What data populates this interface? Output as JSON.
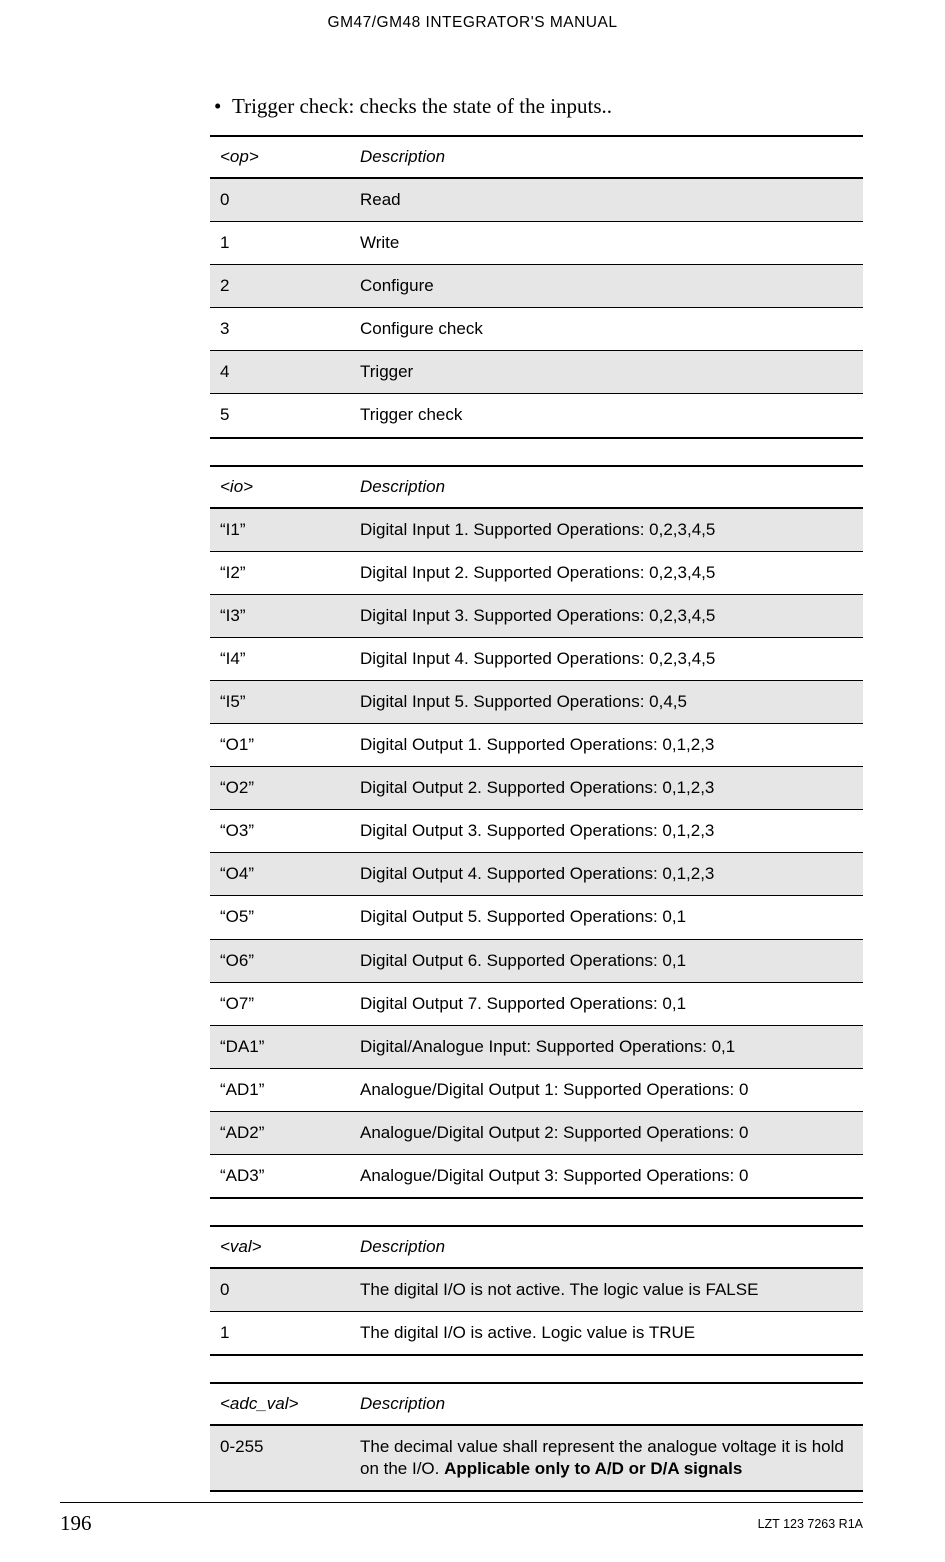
{
  "header": {
    "title": "GM47/GM48 INTEGRATOR'S MANUAL"
  },
  "bullet": {
    "dot": "•",
    "text": "Trigger check: checks the state of the inputs.."
  },
  "table_op": {
    "head": {
      "col1": "<op>",
      "col2": "Description"
    },
    "rows": [
      {
        "c1": "0",
        "c2": "Read"
      },
      {
        "c1": "1",
        "c2": "Write"
      },
      {
        "c1": "2",
        "c2": "Configure"
      },
      {
        "c1": "3",
        "c2": "Configure check"
      },
      {
        "c1": "4",
        "c2": "Trigger"
      },
      {
        "c1": "5",
        "c2": "Trigger check"
      }
    ]
  },
  "table_io": {
    "head": {
      "col1": "<io>",
      "col2": "Description"
    },
    "rows": [
      {
        "c1": "“I1”",
        "c2": "Digital Input 1. Supported Operations: 0,2,3,4,5"
      },
      {
        "c1": "“I2”",
        "c2": "Digital Input 2. Supported Operations: 0,2,3,4,5"
      },
      {
        "c1": "“I3”",
        "c2": "Digital Input 3. Supported Operations: 0,2,3,4,5"
      },
      {
        "c1": "“I4”",
        "c2": "Digital Input 4. Supported Operations: 0,2,3,4,5"
      },
      {
        "c1": "“I5”",
        "c2": "Digital Input 5. Supported Operations: 0,4,5"
      },
      {
        "c1": "“O1”",
        "c2": "Digital Output 1. Supported Operations: 0,1,2,3"
      },
      {
        "c1": "“O2”",
        "c2": "Digital Output 2. Supported Operations: 0,1,2,3"
      },
      {
        "c1": "“O3”",
        "c2": "Digital Output 3. Supported Operations: 0,1,2,3"
      },
      {
        "c1": "“O4”",
        "c2": "Digital Output 4. Supported Operations: 0,1,2,3"
      },
      {
        "c1": "“O5”",
        "c2": "Digital Output 5. Supported Operations: 0,1"
      },
      {
        "c1": "“O6”",
        "c2": "Digital Output 6. Supported Operations: 0,1"
      },
      {
        "c1": "“O7”",
        "c2": "Digital Output 7. Supported Operations: 0,1"
      },
      {
        "c1": "“DA1”",
        "c2": "Digital/Analogue Input: Supported Operations: 0,1"
      },
      {
        "c1": "“AD1”",
        "c2": "Analogue/Digital Output 1: Supported Operations: 0"
      },
      {
        "c1": "“AD2”",
        "c2": "Analogue/Digital Output 2: Supported Operations: 0"
      },
      {
        "c1": "“AD3”",
        "c2": "Analogue/Digital Output 3: Supported Operations: 0"
      }
    ]
  },
  "table_val": {
    "head": {
      "col1": "<val>",
      "col2": "Description"
    },
    "rows": [
      {
        "c1": "0",
        "c2": "The digital I/O is not active. The logic value is FALSE"
      },
      {
        "c1": "1",
        "c2": "The digital I/O is active. Logic value is TRUE"
      }
    ]
  },
  "table_adc": {
    "head": {
      "col1": "<adc_val>",
      "col2": "Description"
    },
    "rows": [
      {
        "c1": "0-255",
        "c2_pre": "The decimal value shall represent the analogue voltage it is hold on the I/O. ",
        "c2_bold": "Applicable only to A/D or D/A signals"
      }
    ]
  },
  "footer": {
    "page": "196",
    "doc_id": "LZT 123 7263 R1A"
  }
}
